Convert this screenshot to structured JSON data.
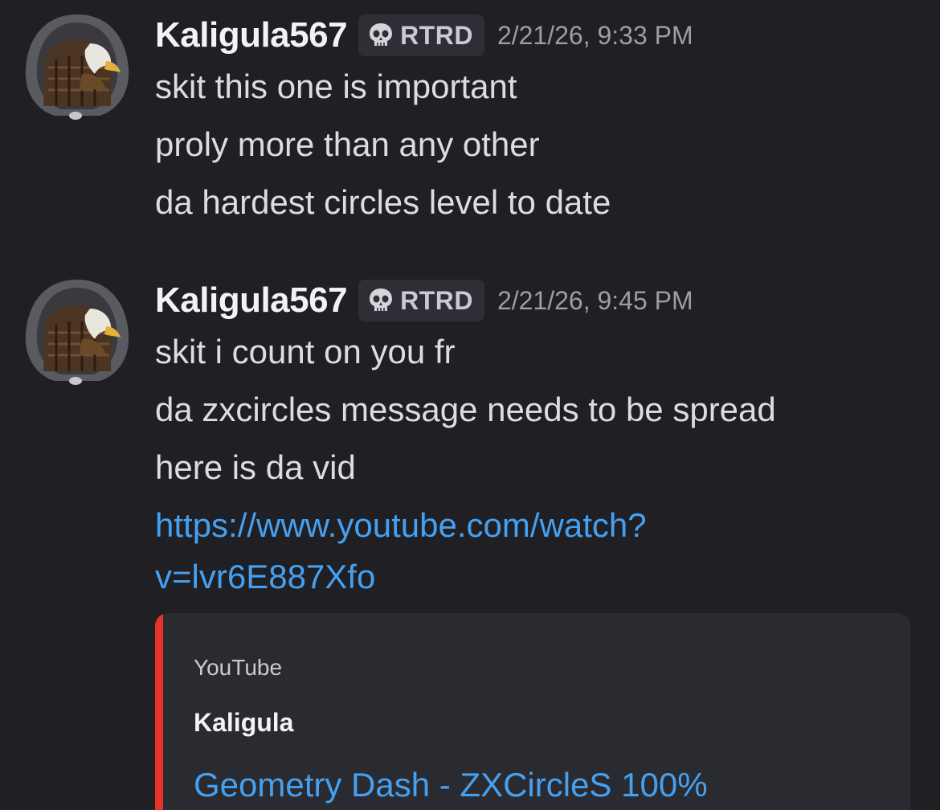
{
  "messages": [
    {
      "author": "Kaligula567",
      "tag": {
        "icon": "skull-icon",
        "label": "RTRD"
      },
      "timestamp": "2/21/26, 9:33 PM",
      "lines": [
        "skit this one is important",
        "proly more than any other",
        "da hardest circles level to date"
      ]
    },
    {
      "author": "Kaligula567",
      "tag": {
        "icon": "skull-icon",
        "label": "RTRD"
      },
      "timestamp": "2/21/26, 9:45 PM",
      "lines": [
        "skit i count on you fr",
        "da zxcircles message needs to be spread",
        "here is da vid"
      ],
      "link": {
        "line1": "https://www.youtube.com/watch?",
        "line2": "v=lvr6E887Xfo"
      },
      "embed": {
        "provider": "YouTube",
        "author": "Kaligula",
        "title": "Geometry Dash - ZXCircleS 100%",
        "accent_color": "#e5332a"
      }
    }
  ],
  "colors": {
    "background": "#1f1f24",
    "username": "#f2f3f5",
    "text": "#dbdee1",
    "timestamp": "#9b9ea6",
    "link": "#46a0f0",
    "tag_background": "#2e2f36"
  }
}
